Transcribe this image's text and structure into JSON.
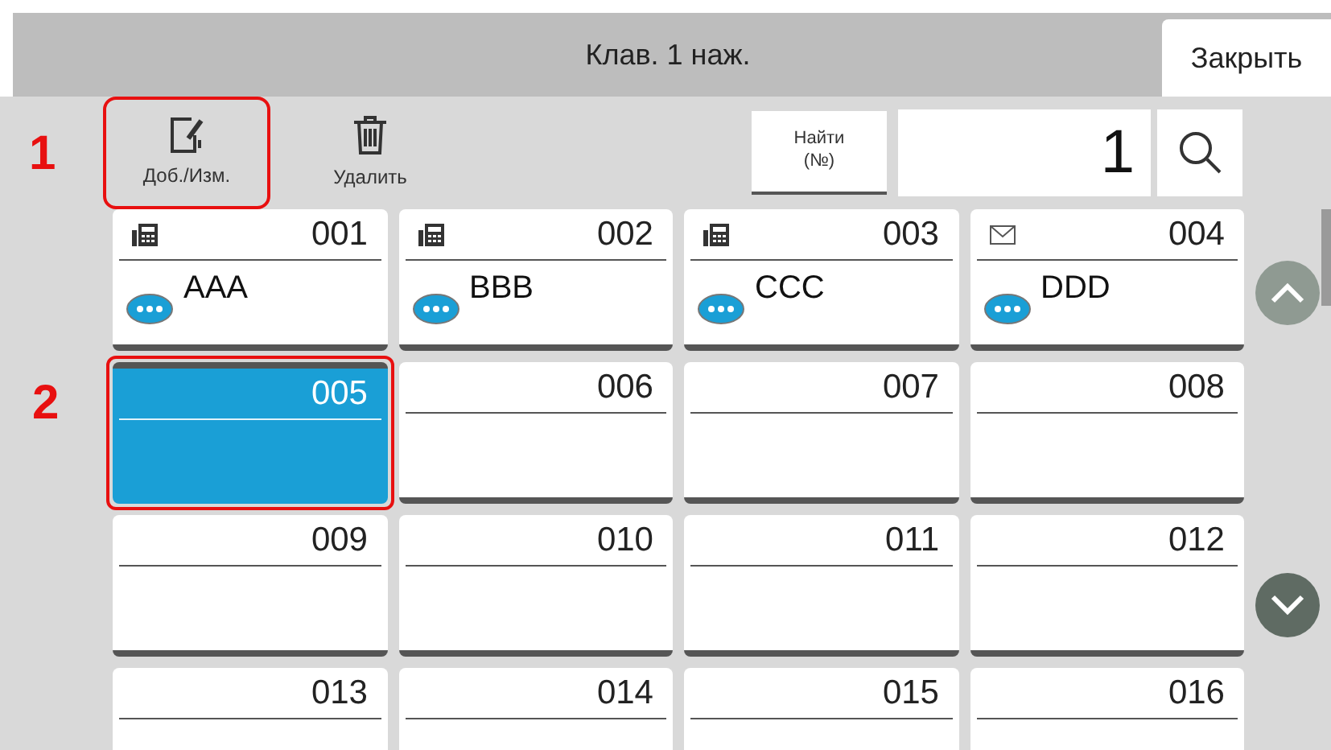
{
  "header": {
    "title": "Клав. 1 наж.",
    "close": "Закрыть"
  },
  "toolbar": {
    "callout": "1",
    "buttons": [
      {
        "kind": "edit",
        "label": "Доб./Изм.",
        "highlighted": true
      },
      {
        "kind": "delete",
        "label": "Удалить",
        "highlighted": false
      }
    ],
    "find_button": "Найти\n(№)",
    "search_value": "1"
  },
  "grid": {
    "callout": "2",
    "cells": [
      {
        "number": "001",
        "kind": "fax",
        "name": "AAA",
        "selected": false,
        "highlighted": false
      },
      {
        "number": "002",
        "kind": "fax",
        "name": "BBB",
        "selected": false,
        "highlighted": false
      },
      {
        "number": "003",
        "kind": "fax",
        "name": "CCC",
        "selected": false,
        "highlighted": false
      },
      {
        "number": "004",
        "kind": "email",
        "name": "DDD",
        "selected": false,
        "highlighted": false
      },
      {
        "number": "005",
        "kind": "empty",
        "selected": true,
        "highlighted": true
      },
      {
        "number": "006",
        "kind": "empty",
        "selected": false,
        "highlighted": false
      },
      {
        "number": "007",
        "kind": "empty",
        "selected": false,
        "highlighted": false
      },
      {
        "number": "008",
        "kind": "empty",
        "selected": false,
        "highlighted": false
      },
      {
        "number": "009",
        "kind": "empty",
        "selected": false,
        "highlighted": false
      },
      {
        "number": "010",
        "kind": "empty",
        "selected": false,
        "highlighted": false
      },
      {
        "number": "011",
        "kind": "empty",
        "selected": false,
        "highlighted": false
      },
      {
        "number": "012",
        "kind": "empty",
        "selected": false,
        "highlighted": false
      },
      {
        "number": "013",
        "kind": "empty",
        "selected": false,
        "highlighted": false
      },
      {
        "number": "014",
        "kind": "empty",
        "selected": false,
        "highlighted": false
      },
      {
        "number": "015",
        "kind": "empty",
        "selected": false,
        "highlighted": false
      },
      {
        "number": "016",
        "kind": "empty",
        "selected": false,
        "highlighted": false
      }
    ]
  }
}
